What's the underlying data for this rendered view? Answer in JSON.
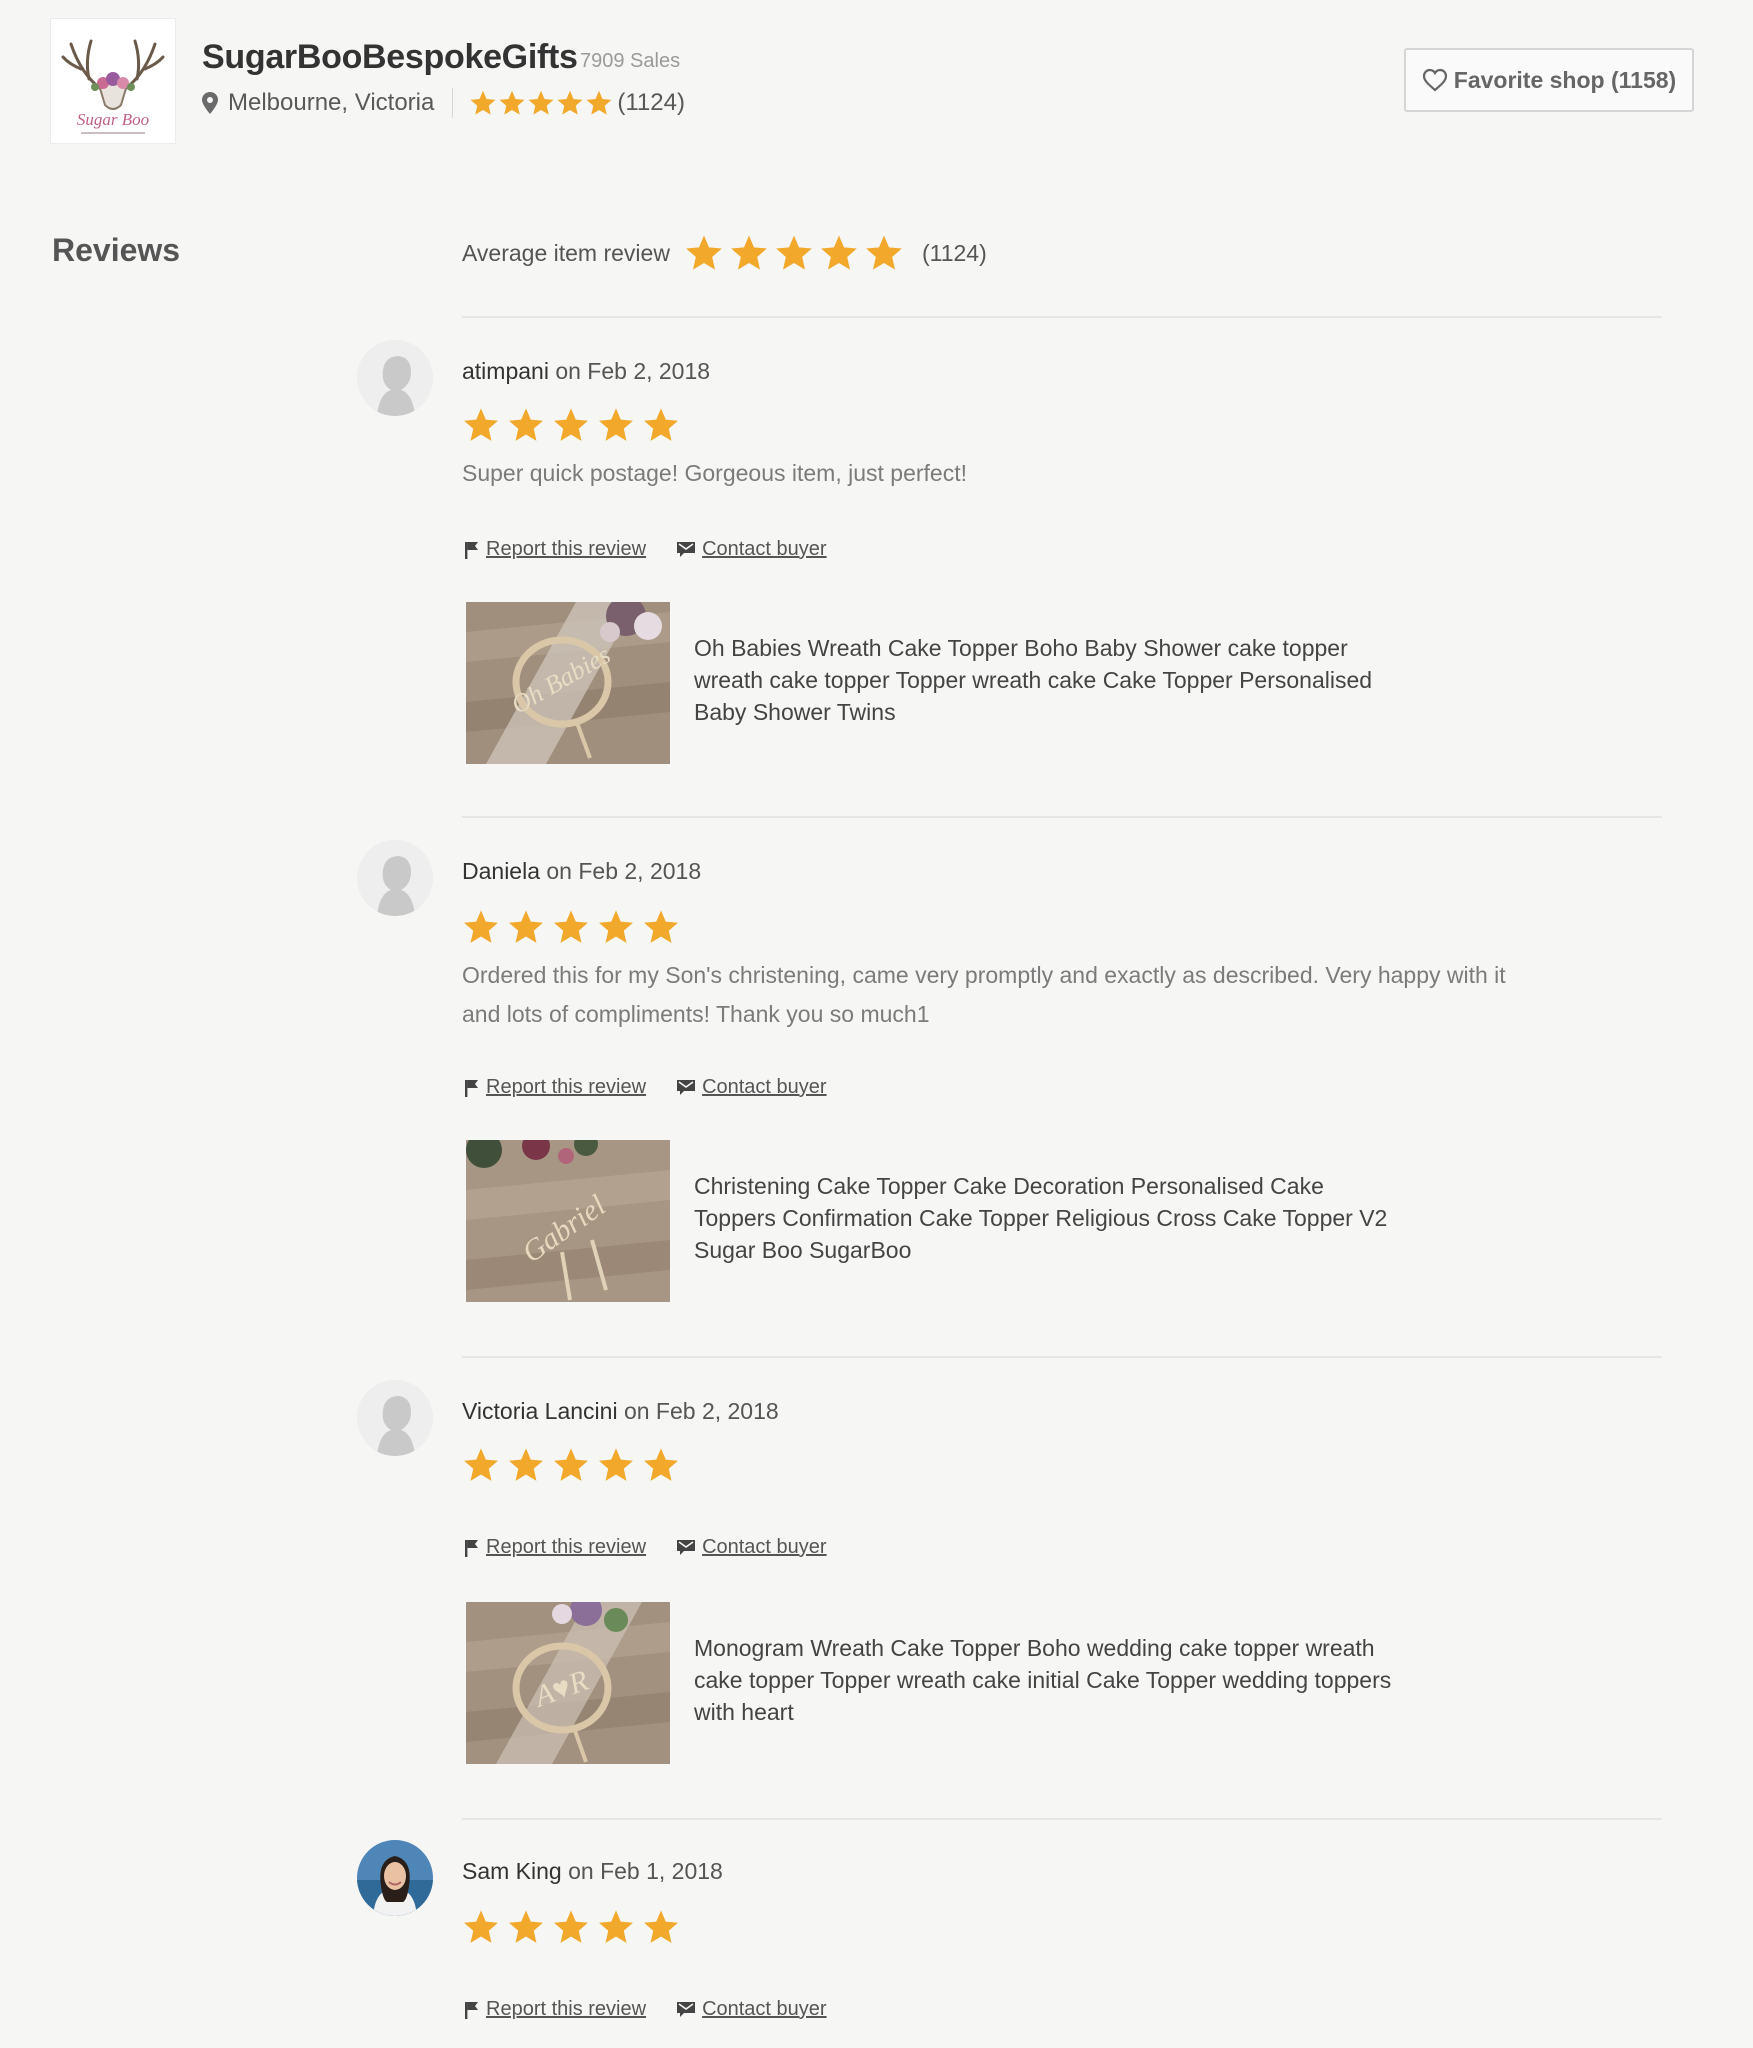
{
  "shop": {
    "name": "SugarBooBespokeGifts",
    "sales": "7909 Sales",
    "location": "Melbourne, Victoria",
    "rating": 5,
    "rating_count": "(1124)",
    "logo_text": "Sugar Boo",
    "favorite_button": "Favorite shop (1158)"
  },
  "reviews_section": {
    "title": "Reviews",
    "average_label": "Average item review",
    "average_rating": 5,
    "average_count": "(1124)"
  },
  "actions": {
    "report": "Report this review",
    "contact": "Contact buyer"
  },
  "reviews": [
    {
      "reviewer": "atimpani",
      "on": "on Feb 2, 2018",
      "rating": 5,
      "text": "Super quick postage! Gorgeous item, just perfect!",
      "item_title": "Oh Babies Wreath Cake Topper Boho Baby Shower cake topper wreath cake topper Topper wreath cake Cake Topper Personalised Baby Shower Twins",
      "item_image_text": "Oh Babies"
    },
    {
      "reviewer": "Daniela",
      "on": "on Feb 2, 2018",
      "rating": 5,
      "text": "Ordered this for my Son's christening, came very promptly and exactly as described. Very happy with it and lots of compliments! Thank you so much1",
      "item_title": "Christening Cake Topper Cake Decoration Personalised Cake Toppers Confirmation Cake Topper Religious Cross Cake Topper V2 Sugar Boo SugarBoo",
      "item_image_text": "Gabriel"
    },
    {
      "reviewer": "Victoria Lancini",
      "on": "on Feb 2, 2018",
      "rating": 5,
      "text": "",
      "item_title": "Monogram Wreath Cake Topper Boho wedding cake topper wreath cake topper Topper wreath cake initial Cake Topper wedding toppers with heart",
      "item_image_text": "A♥R"
    },
    {
      "reviewer": "Sam King",
      "on": "on Feb 1, 2018",
      "rating": 5,
      "text": ""
    }
  ],
  "colors": {
    "star": "#f1a82b",
    "background": "#f6f6f4",
    "divider": "#e6e6e6"
  }
}
